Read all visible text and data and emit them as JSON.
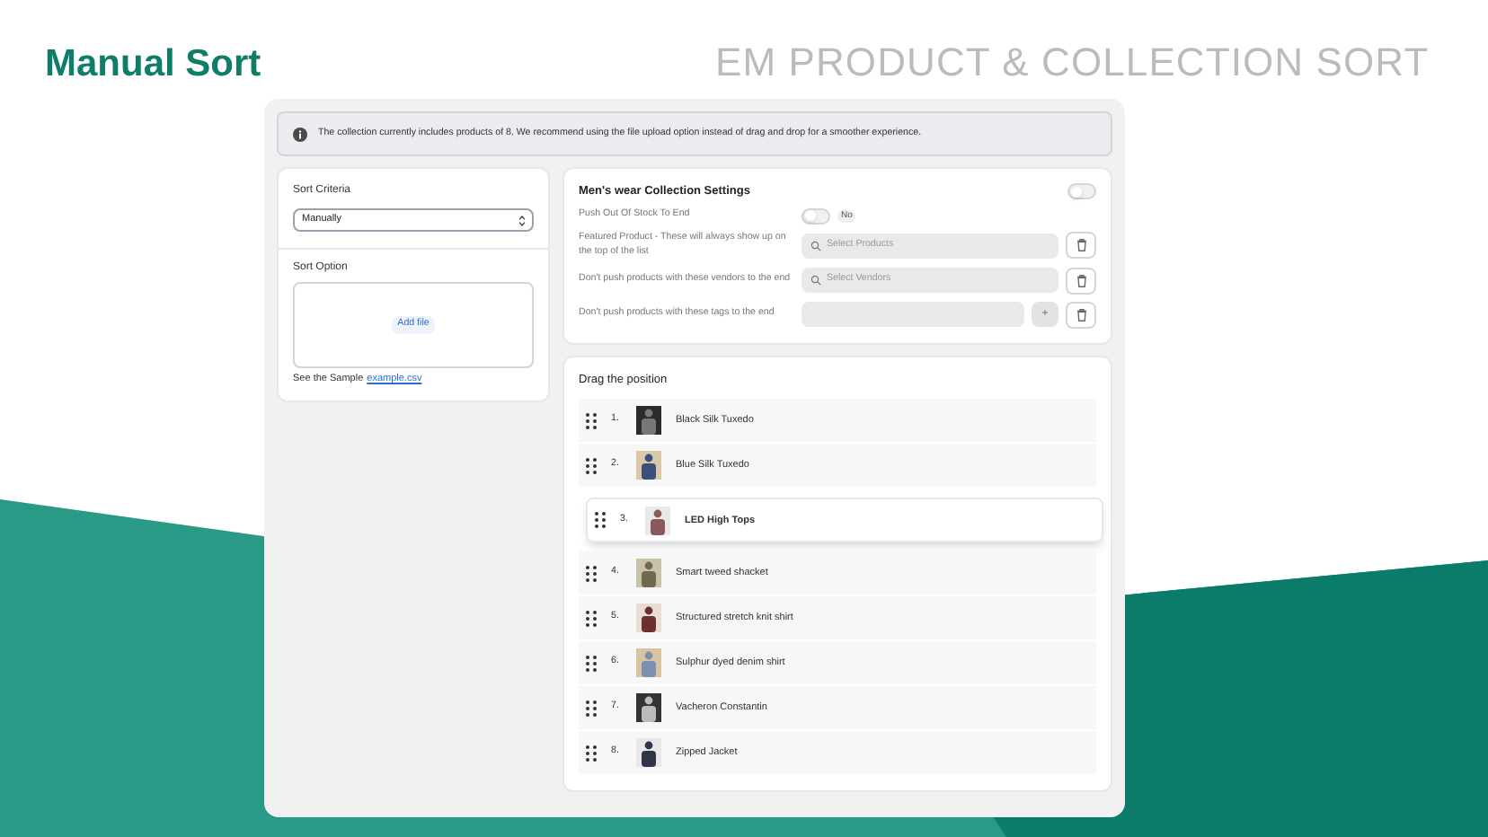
{
  "hero_title": "Manual Sort",
  "brand_title": "EM PRODUCT & COLLECTION SORT",
  "notice": {
    "text": "The collection currently includes products of 8. We recommend using the file upload option instead of drag and drop for a smoother experience."
  },
  "sort_panel": {
    "criteria_label": "Sort Criteria",
    "criteria_value": "Manually",
    "option_label": "Sort Option",
    "upload_button": "Add file",
    "sample_text": "See the Sample",
    "sample_link": "example.csv"
  },
  "settings": {
    "title": "Men's wear Collection Settings",
    "enabled": false,
    "push_out_of_stock": {
      "label": "Push Out Of Stock To End",
      "on": false,
      "state_text": "No"
    },
    "rows": [
      {
        "kind": "search",
        "label": "Featured Product - These will always show up on the top of the list",
        "placeholder": "Select Products"
      },
      {
        "kind": "search",
        "label": "Don't push products with these vendors to the end",
        "placeholder": "Select Vendors"
      },
      {
        "kind": "tags",
        "label": "Don't push products with these tags to the end",
        "add": "+"
      }
    ]
  },
  "drag": {
    "title": "Drag the position",
    "items": [
      {
        "number": "1.",
        "name": "Black Silk Tuxedo",
        "dragging": false
      },
      {
        "number": "2.",
        "name": "Blue Silk Tuxedo",
        "dragging": false
      },
      {
        "number": "3.",
        "name": "LED High Tops",
        "dragging": true
      },
      {
        "number": "4.",
        "name": "Smart tweed shacket",
        "dragging": false
      },
      {
        "number": "5.",
        "name": "Structured stretch knit shirt",
        "dragging": false
      },
      {
        "number": "6.",
        "name": "Sulphur dyed denim shirt",
        "dragging": false
      },
      {
        "number": "7.",
        "name": "Vacheron Constantin",
        "dragging": false
      },
      {
        "number": "8.",
        "name": "Zipped Jacket",
        "dragging": false
      }
    ]
  }
}
